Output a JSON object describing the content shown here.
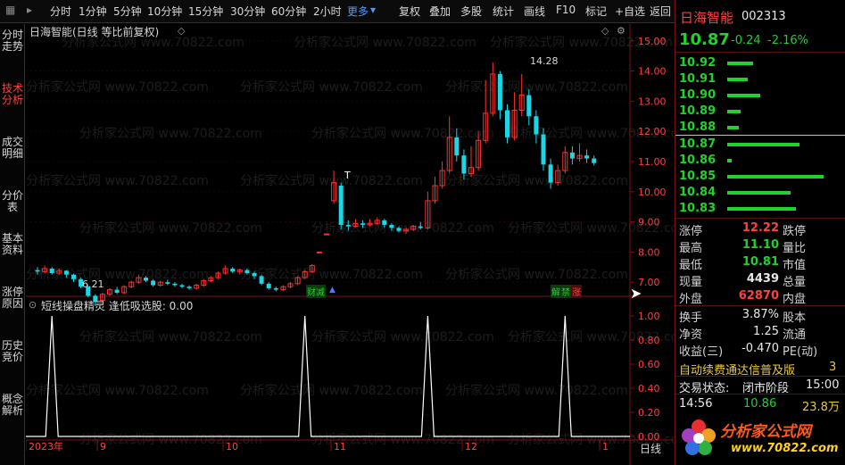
{
  "toolbar": {
    "periods": [
      "分时",
      "1分钟",
      "5分钟",
      "10分钟",
      "15分钟",
      "30分钟",
      "60分钟",
      "2小时"
    ],
    "more": "更多",
    "tools": [
      "复权",
      "叠加",
      "多股",
      "统计",
      "画线",
      "F10",
      "标记",
      "+自选",
      "返回"
    ]
  },
  "sidebar": [
    "分时走势",
    "技术分析",
    "成交明细",
    "分价表",
    "基本资料",
    "涨停原因",
    "历史竞价",
    "概念解析"
  ],
  "chart": {
    "title": "日海智能(日线 等比前复权)",
    "y_axis": [
      "15.00",
      "14.00",
      "13.00",
      "12.00",
      "11.00",
      "10.00",
      "9.00",
      "8.00",
      "7.00"
    ],
    "high_label": "14.28",
    "low_label": "6.21",
    "t_mark": "T",
    "tags": {
      "cut": "财减",
      "unlock": "解",
      "ban": "禁",
      "up": "涨"
    },
    "indicator_title": "短线操盘精灵 逢低吸选股: 0.00",
    "ind_y": [
      "1.00",
      "0.80",
      "0.60",
      "0.40",
      "0.20",
      "0.00"
    ],
    "x_labels": [
      "2023年",
      "9",
      "10",
      "11",
      "12",
      "1"
    ],
    "watermark": "分析家公式网 www.70822.com",
    "x_axis_tail": "日线",
    "chart_data": {
      "type": "candlestick",
      "series": [
        {
          "values": [
            [
              7.4,
              7.35,
              7.5,
              7.25
            ],
            [
              7.35,
              7.45,
              7.55,
              7.3
            ],
            [
              7.45,
              7.3,
              7.5,
              7.25
            ],
            [
              7.3,
              7.38,
              7.45,
              7.25
            ],
            [
              7.38,
              7.25,
              7.4,
              7.15
            ],
            [
              7.25,
              7.1,
              7.28,
              7.0
            ],
            [
              7.1,
              6.85,
              7.15,
              6.8
            ],
            [
              6.85,
              6.55,
              6.9,
              6.5
            ],
            [
              6.55,
              6.35,
              6.6,
              6.21
            ],
            [
              6.4,
              6.6,
              6.65,
              6.35
            ],
            [
              6.6,
              6.75,
              6.8,
              6.55
            ],
            [
              6.75,
              6.65,
              6.85,
              6.6
            ],
            [
              6.65,
              6.85,
              6.9,
              6.6
            ],
            [
              6.85,
              7.0,
              7.05,
              6.8
            ],
            [
              7.0,
              7.15,
              7.25,
              6.95
            ],
            [
              7.15,
              7.05,
              7.2,
              7.0
            ],
            [
              7.05,
              6.9,
              7.1,
              6.85
            ],
            [
              6.9,
              7.0,
              7.05,
              6.85
            ],
            [
              7.0,
              6.95,
              7.08,
              6.9
            ],
            [
              6.95,
              6.9,
              7.0,
              6.85
            ],
            [
              6.9,
              6.85,
              6.95,
              6.8
            ],
            [
              6.85,
              6.8,
              6.9,
              6.75
            ],
            [
              6.8,
              6.9,
              6.95,
              6.75
            ],
            [
              6.9,
              7.05,
              7.1,
              6.85
            ],
            [
              7.05,
              7.15,
              7.2,
              7.0
            ],
            [
              7.15,
              7.3,
              7.35,
              7.1
            ],
            [
              7.3,
              7.45,
              7.55,
              7.25
            ],
            [
              7.45,
              7.35,
              7.5,
              7.3
            ],
            [
              7.35,
              7.4,
              7.45,
              7.25
            ],
            [
              7.4,
              7.3,
              7.45,
              7.25
            ],
            [
              7.3,
              7.2,
              7.35,
              7.1
            ],
            [
              7.2,
              6.95,
              7.25,
              6.9
            ],
            [
              6.95,
              6.8,
              7.0,
              6.75
            ],
            [
              6.8,
              6.75,
              6.85,
              6.7
            ],
            [
              6.75,
              6.85,
              6.9,
              6.7
            ],
            [
              6.85,
              6.95,
              7.0,
              6.8
            ],
            [
              6.95,
              7.15,
              7.2,
              6.9
            ],
            [
              7.15,
              7.35,
              7.4,
              7.1
            ],
            [
              7.35,
              7.55,
              7.6,
              7.3
            ],
            [
              8.0,
              8.0,
              8.0,
              8.0
            ],
            [
              8.6,
              8.6,
              8.6,
              8.6
            ],
            [
              9.7,
              10.3,
              10.7,
              9.6
            ],
            [
              10.2,
              8.9,
              10.3,
              8.75
            ],
            [
              8.9,
              8.85,
              9.05,
              8.7
            ],
            [
              8.85,
              8.95,
              9.1,
              8.8
            ],
            [
              8.95,
              8.9,
              9.05,
              8.8
            ],
            [
              8.9,
              8.95,
              9.1,
              8.85
            ],
            [
              8.95,
              9.05,
              9.15,
              8.9
            ],
            [
              9.05,
              8.9,
              9.1,
              8.8
            ],
            [
              8.9,
              8.8,
              8.95,
              8.7
            ],
            [
              8.8,
              8.7,
              8.85,
              8.65
            ],
            [
              8.7,
              8.75,
              8.8,
              8.6
            ],
            [
              8.75,
              8.85,
              8.9,
              8.7
            ],
            [
              8.85,
              8.8,
              9.0,
              8.75
            ],
            [
              8.8,
              9.7,
              10.0,
              8.75
            ],
            [
              9.7,
              10.2,
              10.5,
              9.6
            ],
            [
              10.2,
              10.7,
              11.0,
              10.1
            ],
            [
              10.7,
              11.8,
              12.5,
              10.6
            ],
            [
              11.8,
              11.2,
              12.1,
              11.0
            ],
            [
              11.2,
              10.6,
              11.4,
              10.4
            ],
            [
              10.6,
              10.8,
              11.5,
              10.5
            ],
            [
              10.8,
              11.7,
              12.0,
              10.7
            ],
            [
              11.7,
              12.6,
              13.7,
              11.6
            ],
            [
              12.6,
              13.9,
              14.28,
              12.5
            ],
            [
              13.9,
              12.7,
              14.0,
              12.4
            ],
            [
              12.7,
              11.8,
              12.9,
              11.6
            ],
            [
              11.8,
              12.7,
              13.3,
              11.7
            ],
            [
              12.7,
              13.2,
              13.9,
              12.5
            ],
            [
              13.2,
              12.5,
              13.4,
              12.2
            ],
            [
              12.5,
              11.9,
              12.7,
              11.6
            ],
            [
              11.9,
              10.9,
              12.1,
              10.7
            ],
            [
              10.9,
              10.3,
              11.1,
              10.1
            ],
            [
              10.3,
              10.7,
              10.9,
              10.2
            ],
            [
              10.7,
              11.3,
              11.5,
              10.6
            ],
            [
              11.3,
              11.1,
              11.5,
              10.9
            ],
            [
              11.1,
              11.2,
              11.6,
              11.0
            ],
            [
              11.2,
              11.1,
              11.4,
              10.95
            ],
            [
              11.1,
              10.95,
              11.2,
              10.87
            ]
          ]
        }
      ],
      "indicator": {
        "peaks_index": [
          2,
          37,
          54,
          73,
          74
        ]
      }
    }
  },
  "stock": {
    "name": "日海智能",
    "code": "002313",
    "price": "10.87",
    "change": "-0.24",
    "pct": "-2.16%"
  },
  "asks": [
    {
      "price": "10.92",
      "vol": 0.27
    },
    {
      "price": "10.91",
      "vol": 0.21
    },
    {
      "price": "10.90",
      "vol": 0.34
    },
    {
      "price": "10.89",
      "vol": 0.14
    },
    {
      "price": "10.88",
      "vol": 0.12
    }
  ],
  "bids": [
    {
      "price": "10.87",
      "vol": 0.75
    },
    {
      "price": "10.86",
      "vol": 0.05
    },
    {
      "price": "10.85",
      "vol": 1.0
    },
    {
      "price": "10.84",
      "vol": 0.66
    },
    {
      "price": "10.83",
      "vol": 0.71
    }
  ],
  "stats": [
    {
      "label": "涨停",
      "value": "12.22",
      "label2": "跌停",
      "color": "red"
    },
    {
      "label": "最高",
      "value": "11.10",
      "label2": "量比",
      "color": "green"
    },
    {
      "label": "最低",
      "value": "10.81",
      "label2": "市值",
      "color": "green"
    },
    {
      "label": "现量",
      "value": "4439",
      "label2": "总量",
      "color": "white"
    },
    {
      "label": "外盘",
      "value": "62870",
      "label2": "内盘",
      "color": "red"
    }
  ],
  "stats2": [
    {
      "label": "换手",
      "value": "3.87%",
      "label2": "股本"
    },
    {
      "label": "净资",
      "value": "1.25",
      "label2": "流通"
    },
    {
      "label": "收益(三)",
      "value": "-0.470",
      "label2": "PE(动)"
    }
  ],
  "promo": "自动续费通达信普及版",
  "promo_num": "3",
  "status": {
    "label": "交易状态:",
    "value": "闭市阶段",
    "time": "15:00"
  },
  "tick": {
    "time": "14:56",
    "price": "10.86",
    "vol": "23.8万"
  },
  "logo": {
    "main": "分析家公式网",
    "url": "www.70822.com"
  }
}
